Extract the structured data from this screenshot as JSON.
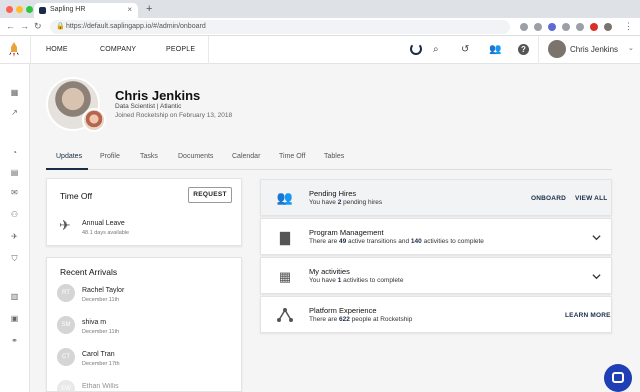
{
  "browser": {
    "tab_title": "Sapling HR",
    "url": "https://default.saplingapp.io/#/admin/onboard"
  },
  "nav": {
    "home": "HOME",
    "company": "COMPANY",
    "people": "PEOPLE",
    "user_name": "Chris Jenkins"
  },
  "profile": {
    "name": "Chris Jenkins",
    "title": "Data Scientist | Atlantic",
    "joined": "Joined Rocketship on February 13, 2018"
  },
  "tabs": [
    "Updates",
    "Profile",
    "Tasks",
    "Documents",
    "Calendar",
    "Time Off",
    "Tables"
  ],
  "time_off": {
    "title": "Time Off",
    "request": "REQUEST",
    "leave_name": "Annual Leave",
    "leave_days": "48.1 days available"
  },
  "recent_arrivals": {
    "title": "Recent Arrivals",
    "people": [
      {
        "initials": "RT",
        "name": "Rachel Taylor",
        "date": "December 11th"
      },
      {
        "initials": "SM",
        "name": "shiva m",
        "date": "December 11th"
      },
      {
        "initials": "CT",
        "name": "Carol Tran",
        "date": "December 17th"
      },
      {
        "initials": "EW",
        "name": "Ethan Willis",
        "date": ""
      }
    ]
  },
  "pending_hires": {
    "title": "Pending Hires",
    "sub_before": "You have ",
    "count": "2",
    "sub_after": " pending hires",
    "onboard": "ONBOARD",
    "view_all": "VIEW ALL"
  },
  "program_management": {
    "title": "Program Management",
    "sub_1": "There are ",
    "transitions": "49",
    "sub_2": " active transitions and ",
    "activities": "140",
    "sub_3": " activities to complete"
  },
  "my_activities": {
    "title": "My activities",
    "sub_1": "You have ",
    "count": "1",
    "sub_2": " activities to complete"
  },
  "platform_experience": {
    "title": "Platform Experience",
    "sub_1": "There are ",
    "count": "622",
    "sub_2": " people at Rocketship",
    "learn_more": "LEARN MORE"
  },
  "colors": {
    "brand": "#1a2c47",
    "chat": "#1f3fb5"
  }
}
